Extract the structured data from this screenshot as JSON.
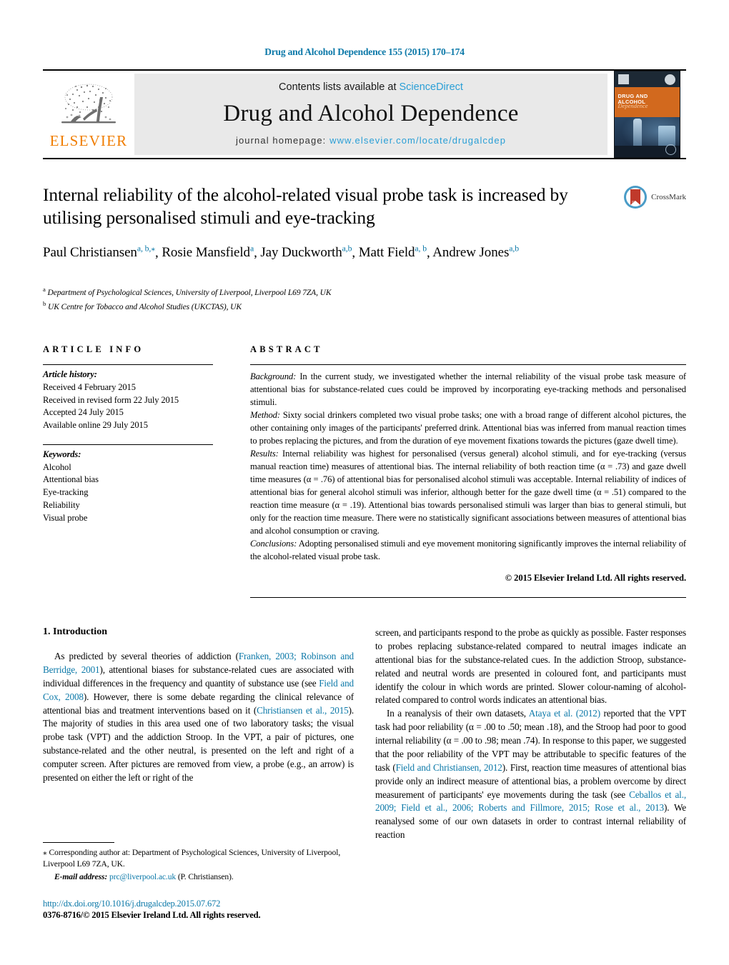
{
  "running_head": "Drug and Alcohol Dependence 155 (2015) 170–174",
  "masthead": {
    "publisher_logo_text": "ELSEVIER",
    "contents_prefix": "Contents lists available at ",
    "contents_link": "ScienceDirect",
    "journal_name": "Drug and Alcohol Dependence",
    "homepage_prefix": "journal homepage: ",
    "homepage_url": "www.elsevier.com/locate/drugalcdep",
    "cover": {
      "title": "DRUG AND ALCOHOL",
      "subtitle": "Dependence"
    }
  },
  "article": {
    "title": "Internal reliability of the alcohol-related visual probe task is increased by utilising personalised stimuli and eye-tracking",
    "crossmark_label": "CrossMark",
    "authors": [
      {
        "name": "Paul Christiansen",
        "sup": "a, b,⁎"
      },
      {
        "name": "Rosie Mansfield",
        "sup": "a"
      },
      {
        "name": "Jay Duckworth",
        "sup": "a,b"
      },
      {
        "name": "Matt Field",
        "sup": "a, b"
      },
      {
        "name": "Andrew Jones",
        "sup": "a,b"
      }
    ],
    "affiliations": [
      {
        "marker": "a",
        "text": "Department of Psychological Sciences, University of Liverpool, Liverpool L69 7ZA, UK"
      },
      {
        "marker": "b",
        "text": "UK Centre for Tobacco and Alcohol Studies (UKCTAS), UK"
      }
    ]
  },
  "article_info": {
    "heading": "ARTICLE INFO",
    "history_label": "Article history:",
    "history": [
      "Received 4 February 2015",
      "Received in revised form 22 July 2015",
      "Accepted 24 July 2015",
      "Available online 29 July 2015"
    ],
    "keywords_label": "Keywords:",
    "keywords": [
      "Alcohol",
      "Attentional bias",
      "Eye-tracking",
      "Reliability",
      "Visual probe"
    ]
  },
  "abstract": {
    "heading": "ABSTRACT",
    "background_label": "Background:",
    "background_text": " In the current study, we investigated whether the internal reliability of the visual probe task measure of attentional bias for substance-related cues could be improved by incorporating eye-tracking methods and personalised stimuli.",
    "method_label": "Method:",
    "method_text": " Sixty social drinkers completed two visual probe tasks; one with a broad range of different alcohol pictures, the other containing only images of the participants' preferred drink. Attentional bias was inferred from manual reaction times to probes replacing the pictures, and from the duration of eye movement fixations towards the pictures (gaze dwell time).",
    "results_label": "Results:",
    "results_text": " Internal reliability was highest for personalised (versus general) alcohol stimuli, and for eye-tracking (versus manual reaction time) measures of attentional bias. The internal reliability of both reaction time (α = .73) and gaze dwell time measures (α = .76) of attentional bias for personalised alcohol stimuli was acceptable. Internal reliability of indices of attentional bias for general alcohol stimuli was inferior, although better for the gaze dwell time (α = .51) compared to the reaction time measure (α = .19). Attentional bias towards personalised stimuli was larger than bias to general stimuli, but only for the reaction time measure. There were no statistically significant associations between measures of attentional bias and alcohol consumption or craving.",
    "conclusions_label": "Conclusions:",
    "conclusions_text": " Adopting personalised stimuli and eye movement monitoring significantly improves the internal reliability of the alcohol-related visual probe task.",
    "copyright": "© 2015 Elsevier Ireland Ltd. All rights reserved."
  },
  "body": {
    "section_number": "1.",
    "section_title": "Introduction",
    "left_column": {
      "para1_a": "As predicted by several theories of addiction (",
      "ref1": "Franken, 2003; Robinson and Berridge, 2001",
      "para1_b": "), attentional biases for substance-related cues are associated with individual differences in the frequency and quantity of substance use (see ",
      "ref2": "Field and Cox, 2008",
      "para1_c": "). However, there is some debate regarding the clinical relevance of attentional bias and treatment interventions based on it (",
      "ref3": "Christiansen et al., 2015",
      "para1_d": "). The majority of studies in this area used one of two laboratory tasks; the visual probe task (VPT) and the addiction Stroop. In the VPT, a pair of pictures, one substance-related and the other neutral, is presented on the left and right of a computer screen. After pictures are removed from view, a probe (e.g., an arrow) is presented on either the left or right of the"
    },
    "right_column": {
      "para_cont": "screen, and participants respond to the probe as quickly as possible. Faster responses to probes replacing substance-related compared to neutral images indicate an attentional bias for the substance-related cues. In the addiction Stroop, substance-related and neutral words are presented in coloured font, and participants must identify the colour in which words are printed. Slower colour-naming of alcohol-related compared to control words indicates an attentional bias.",
      "para2_a": "In a reanalysis of their own datasets, ",
      "ref4": "Ataya et al. (2012)",
      "para2_b": " reported that the VPT task had poor reliability (α = .00 to .50; mean .18), and the Stroop had poor to good internal reliability (α = .00 to .98; mean .74). In response to this paper, we suggested that the poor reliability of the VPT may be attributable to specific features of the task (",
      "ref5": "Field and Christiansen, 2012",
      "para2_c": "). First, reaction time measures of attentional bias provide only an indirect measure of attentional bias, a problem overcome by direct measurement of participants' eye movements during the task (see ",
      "ref6": "Ceballos et al., 2009; Field et al., 2006; Roberts and Fillmore, 2015; Rose et al., 2013",
      "para2_d": "). We reanalysed some of our own datasets in order to contrast internal reliability of reaction"
    }
  },
  "footnotes": {
    "corresponding_star": "⁎",
    "corresponding_text": " Corresponding author at: Department of Psychological Sciences, University of Liverpool, Liverpool L69 7ZA, UK.",
    "email_label": "E-mail address:",
    "email": "prc@liverpool.ac.uk",
    "email_suffix": " (P. Christiansen).",
    "doi": "http://dx.doi.org/10.1016/j.drugalcdep.2015.07.672",
    "issn_line": "0376-8716/© 2015 Elsevier Ireland Ltd. All rights reserved."
  },
  "colors": {
    "link_blue": "#0b78a8",
    "sciencedirect_blue": "#2a9fd6",
    "elsevier_orange": "#f07d00",
    "band_gray": "#e9e9e9"
  }
}
